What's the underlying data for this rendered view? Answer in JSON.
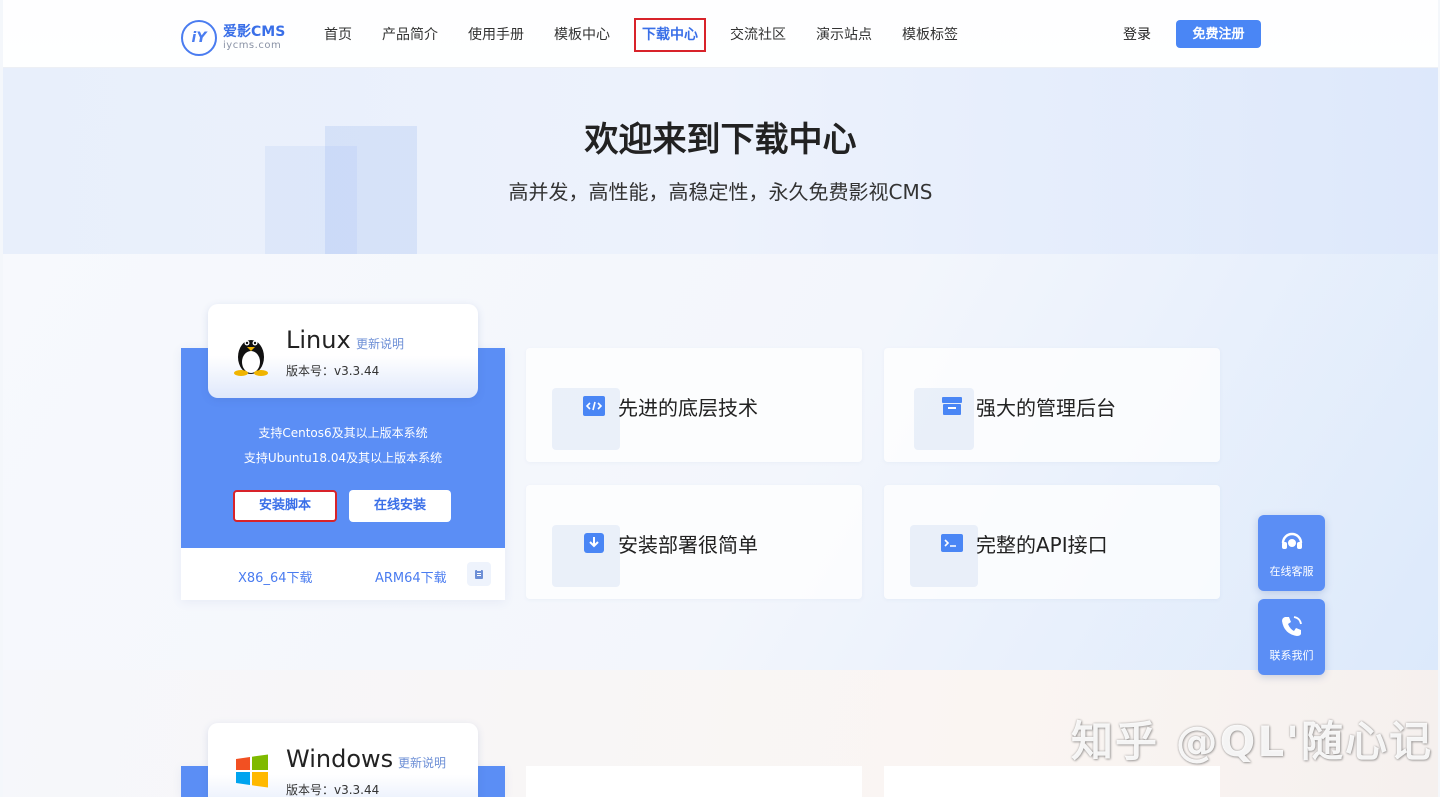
{
  "header": {
    "logo_name": "爱影CMS",
    "logo_domain": "iycms.com",
    "logo_mark": "iY",
    "nav": [
      "首页",
      "产品简介",
      "使用手册",
      "模板中心",
      "下载中心",
      "交流社区",
      "演示站点",
      "模板标签"
    ],
    "active_nav": "下载中心",
    "login": "登录",
    "register": "免费注册"
  },
  "hero": {
    "title": "欢迎来到下载中心",
    "subtitle": "高并发，高性能，高稳定性，永久免费影视CMS"
  },
  "linux": {
    "name": "Linux",
    "notes": "更新说明",
    "version": "版本号：v3.3.44",
    "support1": "支持Centos6及其以上版本系统",
    "support2": "支持Ubuntu18.04及其以上版本系统",
    "btn_script": "安装脚本",
    "btn_online": "在线安装",
    "dl_x86": "X86_64下载",
    "dl_arm": "ARM64下载"
  },
  "windows": {
    "name": "Windows",
    "notes": "更新说明",
    "version": "版本号：v3.3.44"
  },
  "features": [
    {
      "label": "先进的底层技术",
      "icon": "code-icon"
    },
    {
      "label": "强大的管理后台",
      "icon": "inbox-icon"
    },
    {
      "label": "安装部署很简单",
      "icon": "download-icon"
    },
    {
      "label": "完整的API接口",
      "icon": "terminal-icon"
    }
  ],
  "float": {
    "service": "在线客服",
    "contact": "联系我们"
  },
  "watermark": "知乎 @QL'随心记",
  "colors": {
    "accent": "#4a86f5",
    "card_blue": "#5b8ef5",
    "highlight": "#d8232a"
  }
}
